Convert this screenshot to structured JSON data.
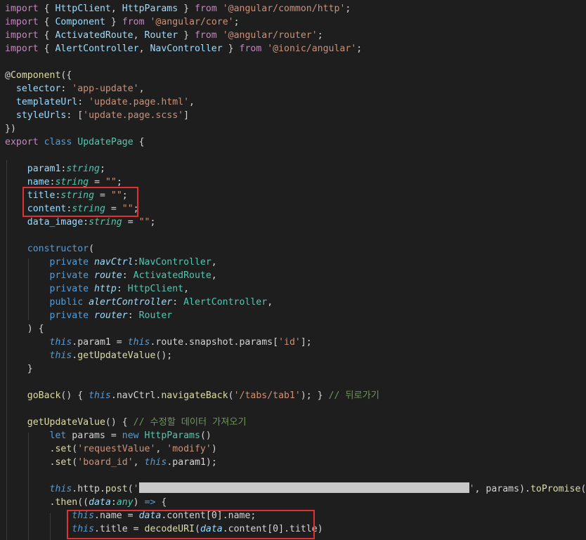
{
  "colors": {
    "background": "#1e1e1e",
    "keyword": "#c586c0",
    "storage": "#569cd6",
    "class": "#4ec9b0",
    "string": "#ce9178",
    "function": "#dcdcaa",
    "variable": "#9cdcfe",
    "plain": "#d4d4d4",
    "comment": "#6a9955",
    "highlight_box": "#e03030"
  },
  "code": {
    "lines": [
      [
        [
          "import",
          "k"
        ],
        [
          " { ",
          "p"
        ],
        [
          "HttpClient",
          "v"
        ],
        [
          ", ",
          "p"
        ],
        [
          "HttpParams",
          "v"
        ],
        [
          " } ",
          "p"
        ],
        [
          "from",
          "k"
        ],
        [
          " ",
          "p"
        ],
        [
          "'@angular/common/http'",
          "s"
        ],
        [
          ";",
          "p"
        ]
      ],
      [
        [
          "import",
          "k"
        ],
        [
          " { ",
          "p"
        ],
        [
          "Component",
          "v"
        ],
        [
          " } ",
          "p"
        ],
        [
          "from",
          "k"
        ],
        [
          " ",
          "p"
        ],
        [
          "'@angular/core'",
          "s"
        ],
        [
          ";",
          "p"
        ]
      ],
      [
        [
          "import",
          "k"
        ],
        [
          " { ",
          "p"
        ],
        [
          "ActivatedRoute",
          "v"
        ],
        [
          ", ",
          "p"
        ],
        [
          "Router",
          "v"
        ],
        [
          " } ",
          "p"
        ],
        [
          "from",
          "k"
        ],
        [
          " ",
          "p"
        ],
        [
          "'@angular/router'",
          "s"
        ],
        [
          ";",
          "p"
        ]
      ],
      [
        [
          "import",
          "k"
        ],
        [
          " { ",
          "p"
        ],
        [
          "AlertController",
          "v"
        ],
        [
          ", ",
          "p"
        ],
        [
          "NavController",
          "v"
        ],
        [
          " } ",
          "p"
        ],
        [
          "from",
          "k"
        ],
        [
          " ",
          "p"
        ],
        [
          "'@ionic/angular'",
          "s"
        ],
        [
          ";",
          "p"
        ]
      ],
      [],
      [
        [
          "@",
          "p"
        ],
        [
          "Component",
          "f"
        ],
        [
          "({",
          "p"
        ]
      ],
      [
        [
          "  selector",
          "v"
        ],
        [
          ": ",
          "p"
        ],
        [
          "'app-update'",
          "s"
        ],
        [
          ",",
          "p"
        ]
      ],
      [
        [
          "  templateUrl",
          "v"
        ],
        [
          ": ",
          "p"
        ],
        [
          "'update.page.html'",
          "s"
        ],
        [
          ",",
          "p"
        ]
      ],
      [
        [
          "  styleUrls",
          "v"
        ],
        [
          ": [",
          "p"
        ],
        [
          "'update.page.scss'",
          "s"
        ],
        [
          "]",
          "p"
        ]
      ],
      [
        [
          "})",
          "p"
        ]
      ],
      [
        [
          "export",
          "k"
        ],
        [
          " ",
          "p"
        ],
        [
          "class",
          "b"
        ],
        [
          " ",
          "p"
        ],
        [
          "UpdatePage",
          "c"
        ],
        [
          " {",
          "p"
        ]
      ],
      [],
      [
        [
          "    param1",
          "v"
        ],
        [
          ":",
          "p"
        ],
        [
          "string",
          "ci"
        ],
        [
          ";",
          "p"
        ]
      ],
      [
        [
          "    name",
          "v"
        ],
        [
          ":",
          "p"
        ],
        [
          "string",
          "ci"
        ],
        [
          " = ",
          "p"
        ],
        [
          "\"\"",
          "s"
        ],
        [
          ";",
          "p"
        ]
      ],
      [
        [
          "    title",
          "v"
        ],
        [
          ":",
          "p"
        ],
        [
          "string",
          "ci"
        ],
        [
          " = ",
          "p"
        ],
        [
          "\"\"",
          "s"
        ],
        [
          ";",
          "p"
        ]
      ],
      [
        [
          "    content",
          "v"
        ],
        [
          ":",
          "p"
        ],
        [
          "string",
          "ci"
        ],
        [
          " = ",
          "p"
        ],
        [
          "\"\"",
          "s"
        ],
        [
          ";",
          "p"
        ]
      ],
      [
        [
          "    data_image",
          "v"
        ],
        [
          ":",
          "p"
        ],
        [
          "string",
          "ci"
        ],
        [
          " = ",
          "p"
        ],
        [
          "\"\"",
          "s"
        ],
        [
          ";",
          "p"
        ]
      ],
      [],
      [
        [
          "    constructor",
          "b"
        ],
        [
          "(",
          "p"
        ]
      ],
      [
        [
          "        private",
          "b"
        ],
        [
          " ",
          "p"
        ],
        [
          "navCtrl",
          "vi"
        ],
        [
          ":",
          "p"
        ],
        [
          "NavController",
          "c"
        ],
        [
          ",",
          "p"
        ]
      ],
      [
        [
          "        private",
          "b"
        ],
        [
          " ",
          "p"
        ],
        [
          "route",
          "vi"
        ],
        [
          ": ",
          "p"
        ],
        [
          "ActivatedRoute",
          "c"
        ],
        [
          ",",
          "p"
        ]
      ],
      [
        [
          "        private",
          "b"
        ],
        [
          " ",
          "p"
        ],
        [
          "http",
          "vi"
        ],
        [
          ": ",
          "p"
        ],
        [
          "HttpClient",
          "c"
        ],
        [
          ",",
          "p"
        ]
      ],
      [
        [
          "        public",
          "b"
        ],
        [
          " ",
          "p"
        ],
        [
          "alertController",
          "vi"
        ],
        [
          ": ",
          "p"
        ],
        [
          "AlertController",
          "c"
        ],
        [
          ",",
          "p"
        ]
      ],
      [
        [
          "        private",
          "b"
        ],
        [
          " ",
          "p"
        ],
        [
          "router",
          "vi"
        ],
        [
          ": ",
          "p"
        ],
        [
          "Router",
          "c"
        ]
      ],
      [
        [
          "    ) {",
          "p"
        ]
      ],
      [
        [
          "        this",
          "bi"
        ],
        [
          ".param1 = ",
          "p"
        ],
        [
          "this",
          "bi"
        ],
        [
          ".route.snapshot.params[",
          "p"
        ],
        [
          "'id'",
          "s"
        ],
        [
          "];",
          "p"
        ]
      ],
      [
        [
          "        this",
          "bi"
        ],
        [
          ".",
          "p"
        ],
        [
          "getUpdateValue",
          "f"
        ],
        [
          "();",
          "p"
        ]
      ],
      [
        [
          "    }",
          "p"
        ]
      ],
      [],
      [
        [
          "    goBack",
          "f"
        ],
        [
          "() { ",
          "p"
        ],
        [
          "this",
          "bi"
        ],
        [
          ".navCtrl.",
          "p"
        ],
        [
          "navigateBack",
          "f"
        ],
        [
          "(",
          "p"
        ],
        [
          "'/tabs/tab1'",
          "s"
        ],
        [
          "); } ",
          "p"
        ],
        [
          "// 뒤로가기",
          "cm"
        ]
      ],
      [],
      [
        [
          "    getUpdateValue",
          "f"
        ],
        [
          "() { ",
          "p"
        ],
        [
          "// 수정할 데이터 가져오기",
          "cm"
        ]
      ],
      [
        [
          "        let",
          "b"
        ],
        [
          " params = ",
          "p"
        ],
        [
          "new",
          "b"
        ],
        [
          " ",
          "p"
        ],
        [
          "HttpParams",
          "c"
        ],
        [
          "()",
          "p"
        ]
      ],
      [
        [
          "        .",
          "p"
        ],
        [
          "set",
          "f"
        ],
        [
          "(",
          "p"
        ],
        [
          "'requestValue'",
          "s"
        ],
        [
          ", ",
          "p"
        ],
        [
          "'modify'",
          "s"
        ],
        [
          ")",
          "p"
        ]
      ],
      [
        [
          "        .",
          "p"
        ],
        [
          "set",
          "f"
        ],
        [
          "(",
          "p"
        ],
        [
          "'board_id'",
          "s"
        ],
        [
          ", ",
          "p"
        ],
        [
          "this",
          "bi"
        ],
        [
          ".param1);",
          "p"
        ]
      ],
      [],
      [
        [
          "        this",
          "bi"
        ],
        [
          ".http.",
          "p"
        ],
        [
          "post",
          "f"
        ],
        [
          "(",
          "p"
        ],
        [
          "'",
          "s"
        ],
        [
          "",
          "r"
        ],
        [
          "'",
          "s"
        ],
        [
          ", params).",
          "p"
        ],
        [
          "toPromise",
          "f"
        ],
        [
          "()",
          "p"
        ]
      ],
      [
        [
          "        .",
          "p"
        ],
        [
          "then",
          "f"
        ],
        [
          "((",
          "p"
        ],
        [
          "data",
          "vi"
        ],
        [
          ":",
          "p"
        ],
        [
          "any",
          "ci"
        ],
        [
          ") ",
          "p"
        ],
        [
          "=>",
          "b"
        ],
        [
          " {",
          "p"
        ]
      ],
      [
        [
          "            this",
          "bi"
        ],
        [
          ".name = ",
          "p"
        ],
        [
          "data",
          "vi"
        ],
        [
          ".content[",
          "p"
        ],
        [
          "0",
          "n"
        ],
        [
          "].name;",
          "p"
        ]
      ],
      [
        [
          "            this",
          "bi"
        ],
        [
          ".title = ",
          "p"
        ],
        [
          "decodeURI",
          "f"
        ],
        [
          "(",
          "p"
        ],
        [
          "data",
          "vi"
        ],
        [
          ".content[",
          "p"
        ],
        [
          "0",
          "n"
        ],
        [
          "].title)",
          "p"
        ]
      ]
    ]
  }
}
